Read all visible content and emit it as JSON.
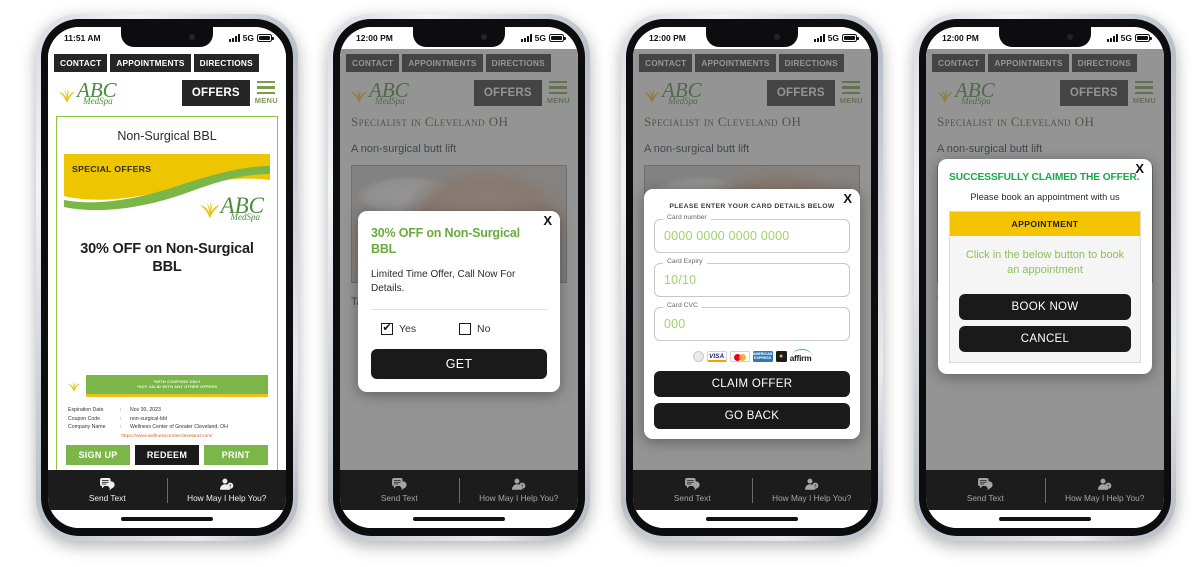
{
  "status": {
    "time_1": "11:51 AM",
    "time_2": "12:00 PM",
    "network": "5G"
  },
  "nav": {
    "contact": "CONTACT",
    "appointments": "APPOINTMENTS",
    "directions": "DIRECTIONS",
    "offers": "OFFERS",
    "menu": "MENU"
  },
  "brand": {
    "name": "ABC",
    "tagline": "MedSpa"
  },
  "coupon": {
    "title": "Non-Surgical BBL",
    "banner_label": "SPECIAL OFFERS",
    "headline": "30% OFF on Non-Surgical BBL",
    "disclaimer_line1": "*WITH COUPONS ONLY",
    "disclaimer_line2": "*NOT VALID WITH ANY OTHER OFFERS",
    "rows": [
      {
        "label": "Expiration Date",
        "sep": ":",
        "value": "Nov 30, 2023"
      },
      {
        "label": "Coupon Code",
        "sep": ":",
        "value": "non-surgical-bbl"
      },
      {
        "label": "Company Name",
        "sep": ":",
        "value": "Wellness Center of Greater Cleveland, OH"
      }
    ],
    "link": "https://www.wellnesscentercleveland.com/",
    "buttons": {
      "signup": "SIGN UP",
      "redeem": "REDEEM",
      "print": "PRINT"
    }
  },
  "article": {
    "heading": "Specialist in Cleveland OH",
    "subheading": "A non-surgical butt lift",
    "toc": "Table of Contents:"
  },
  "bottombar": {
    "send_text": "Send Text",
    "help": "How May I Help You?"
  },
  "modal_offer": {
    "close": "X",
    "title": "30% OFF on Non-Surgical BBL",
    "body": "Limited Time Offer, Call Now For Details.",
    "yes": "Yes",
    "no": "No",
    "yes_checked": "✔",
    "get": "GET"
  },
  "modal_card": {
    "close": "X",
    "heading": "PLEASE ENTER YOUR CARD DETAILS BELOW",
    "fields": [
      {
        "label": "Card number",
        "value": "0000 0000 0000 0000"
      },
      {
        "label": "Card Expiry",
        "value": "10/10"
      },
      {
        "label": "Card CVC",
        "value": "000"
      }
    ],
    "logos": [
      "discover-icon",
      "visa-icon",
      "mastercard-icon",
      "amex-icon",
      "dark-card-icon",
      "affirm-icon"
    ],
    "visa_text": "VISA",
    "amex_text": "AMERICAN EXPRESS",
    "affirm_text": "affirm",
    "claim": "CLAIM OFFER",
    "goback": "GO BACK"
  },
  "modal_success": {
    "close": "X",
    "title": "SUCCESSFULLY CLAIMED THE OFFER.",
    "subtitle": "Please book an appointment with us",
    "card_header": "APPOINTMENT",
    "card_body": "Click in the below button to book an appointment",
    "book": "BOOK NOW",
    "cancel": "CANCEL"
  },
  "colors": {
    "brand_green": "#4c8c3f",
    "accent_green": "#7ab648",
    "offer_green": "#6aab3c",
    "success_green": "#1aa84a",
    "gold": "#f4c400",
    "dark": "#1a1a1a"
  }
}
